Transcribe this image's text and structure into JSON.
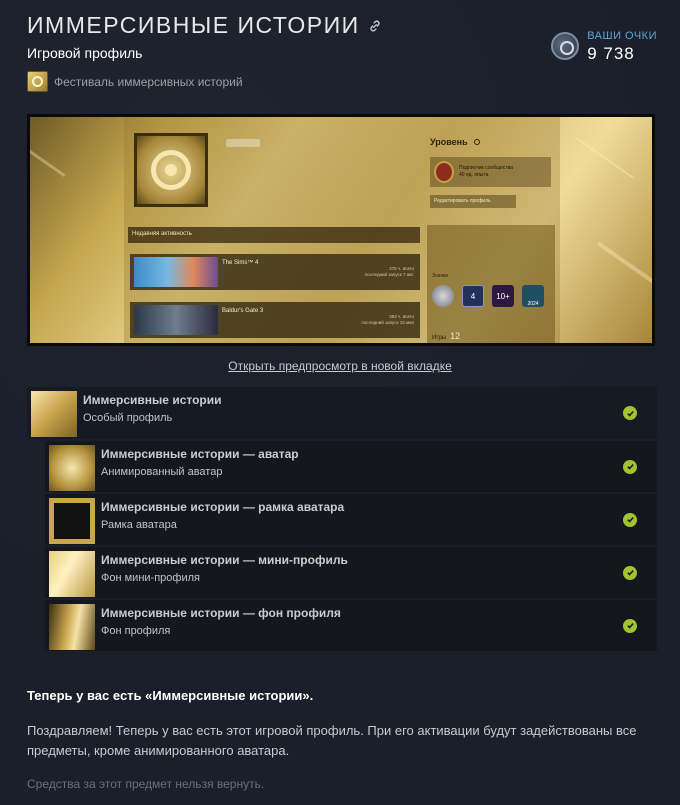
{
  "header": {
    "title": "ИММЕРСИВНЫЕ ИСТОРИИ",
    "subtitle": "Игровой профиль",
    "festival": "Фестиваль иммерсивных историй"
  },
  "points": {
    "label": "ВАШИ ОЧКИ",
    "value": "9 738"
  },
  "preview": {
    "level_label": "Уровень",
    "badge_text_1": "Подписчик сообщества",
    "badge_text_2": "40 ед. опыта",
    "edit_profile": "Редактировать профиль",
    "recent_activity": "Недавняя активность",
    "games": [
      {
        "name": "The Sims™ 4",
        "hours": "275 ч. всего",
        "last": "последний запуск 7 авг."
      },
      {
        "name": "Baldur's Gate 3",
        "hours": "393 ч. всего",
        "last": "последний запуск 15 мая"
      }
    ],
    "badges_label": "Значки",
    "badge_values": [
      "4",
      "10+",
      "2024"
    ],
    "games_label": "Игры",
    "games_count": "12"
  },
  "open_link": "Открыть предпросмотр в новой вкладке",
  "items": [
    {
      "title": "Иммерсивные истории",
      "type": "Особый профиль"
    },
    {
      "title": "Иммерсивные истории — аватар",
      "type": "Анимированный аватар"
    },
    {
      "title": "Иммерсивные истории — рамка аватара",
      "type": "Рамка аватара"
    },
    {
      "title": "Иммерсивные истории — мини-профиль",
      "type": "Фон мини-профиля"
    },
    {
      "title": "Иммерсивные истории — фон профиля",
      "type": "Фон профиля"
    }
  ],
  "footer": {
    "heading": "Теперь у вас есть «Иммерсивные истории».",
    "body": "Поздравляем! Теперь у вас есть этот игровой профиль. При его активации будут задействованы все предметы, кроме анимированного аватара.",
    "note": "Средства за этот предмет нельзя вернуть."
  },
  "colors": {
    "accent_blue": "#5fa6d8",
    "check_green": "#a2c430",
    "background": "#1b1f2a"
  },
  "icons": [
    "link-icon",
    "steam-points-icon",
    "check-icon"
  ]
}
